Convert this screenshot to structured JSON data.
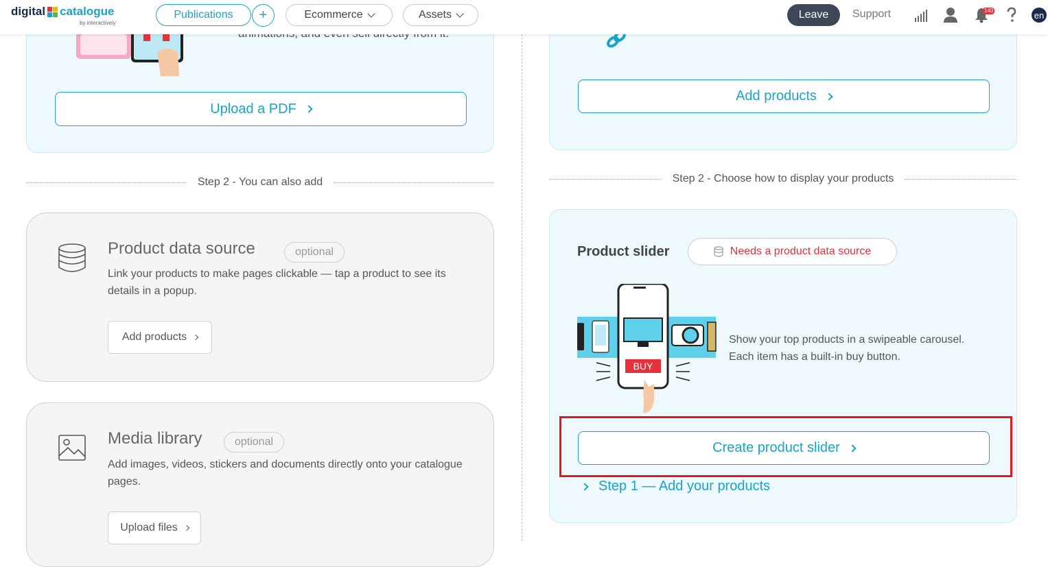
{
  "nav": {
    "logo_text_1": "digital",
    "logo_text_2": "catalogue",
    "logo_sub": "by interactively",
    "publications": "Publications",
    "plus": "+",
    "ecommerce": "Ecommerce",
    "assets": "Assets",
    "leave": "Leave",
    "support": "Support",
    "notification_count": "140",
    "lang": "en"
  },
  "left": {
    "top_card_text": "animations, and even sell directly from it.",
    "upload_pdf": "Upload a PDF",
    "step2_label": "Step 2 - You can also add",
    "data_source": {
      "title": "Product data source",
      "optional": "optional",
      "desc": "Link your products to make pages clickable — tap a product to see its details in a popup.",
      "button": "Add products"
    },
    "media": {
      "title": "Media library",
      "optional": "optional",
      "desc": "Add images, videos, stickers and documents directly onto your catalogue pages.",
      "button": "Upload files"
    }
  },
  "right": {
    "add_products": "Add products",
    "step2_label": "Step 2 - Choose how to display your products",
    "slider": {
      "title": "Product slider",
      "needs": "Needs a product data source",
      "desc": "Show your top products in a swipeable carousel. Each item has a built-in buy button.",
      "buy": "BUY",
      "create": "Create product slider",
      "step1": "Step 1 — Add your products"
    }
  },
  "colors": {
    "accent": "#1aa3c9",
    "dark": "#3d4757",
    "warning": "#e0171f"
  }
}
